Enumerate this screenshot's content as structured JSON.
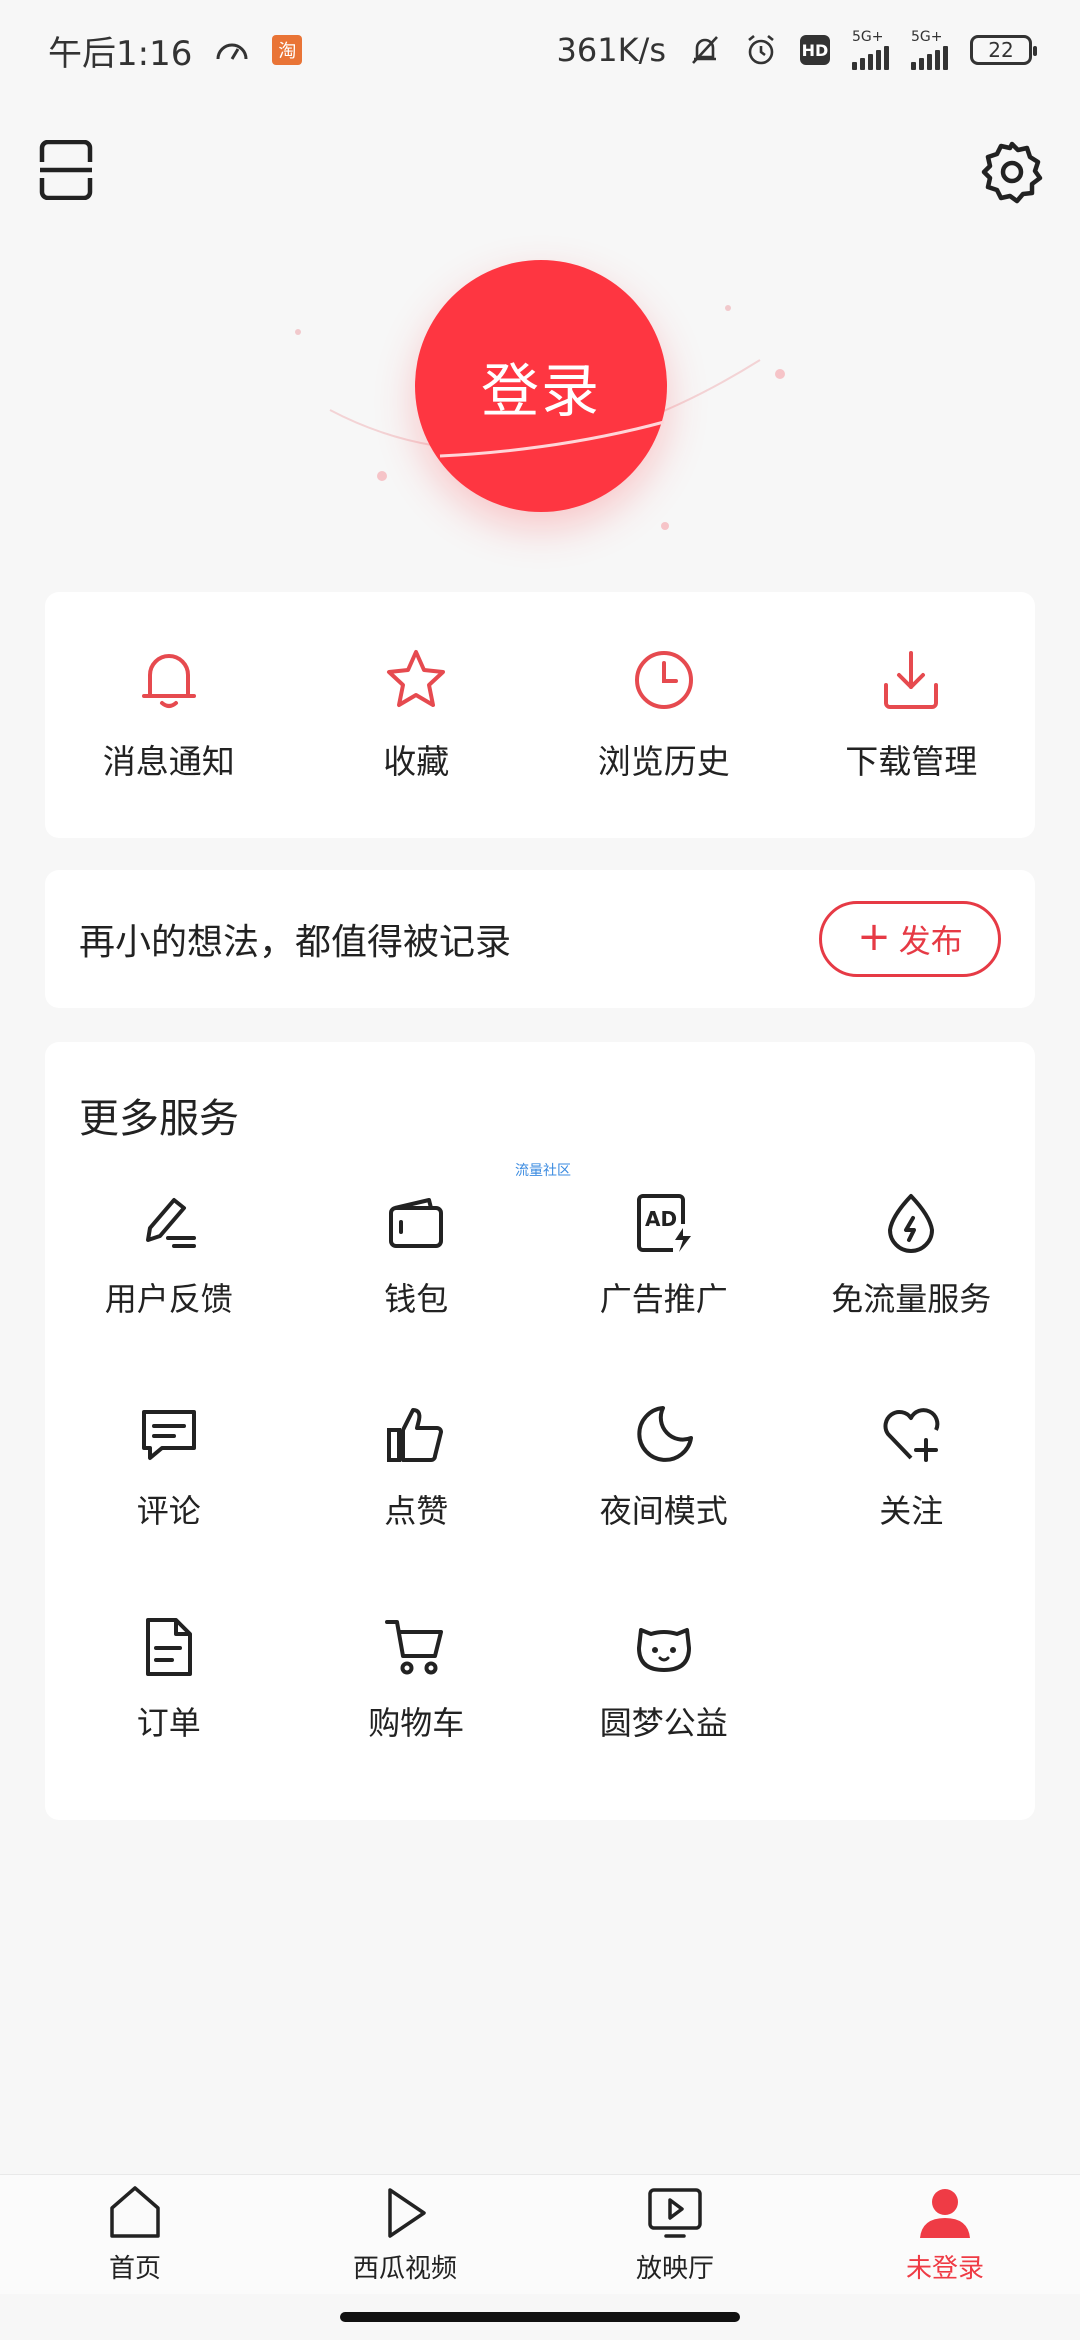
{
  "status_bar": {
    "time": "午后1:16",
    "speed": "361K/s",
    "taobao_badge": "淘",
    "hd": "HD",
    "net1": "5G+",
    "net2": "5G+",
    "battery": "22"
  },
  "login": {
    "label": "登录"
  },
  "quick": [
    {
      "label": "消息通知",
      "icon": "bell-icon"
    },
    {
      "label": "收藏",
      "icon": "star-icon"
    },
    {
      "label": "浏览历史",
      "icon": "clock-icon"
    },
    {
      "label": "下载管理",
      "icon": "download-icon"
    }
  ],
  "post": {
    "text": "再小的想法，都值得被记录",
    "button": "发布",
    "plus": "+"
  },
  "more": {
    "title": "更多服务",
    "watermark": "流量社区",
    "items": [
      {
        "label": "用户反馈",
        "icon": "pencil-icon"
      },
      {
        "label": "钱包",
        "icon": "wallet-icon"
      },
      {
        "label": "广告推广",
        "icon": "ad-icon"
      },
      {
        "label": "免流量服务",
        "icon": "drop-icon"
      },
      {
        "label": "评论",
        "icon": "comment-icon"
      },
      {
        "label": "点赞",
        "icon": "thumb-up-icon"
      },
      {
        "label": "夜间模式",
        "icon": "moon-icon"
      },
      {
        "label": "关注",
        "icon": "heart-plus-icon"
      },
      {
        "label": "订单",
        "icon": "document-icon"
      },
      {
        "label": "购物车",
        "icon": "cart-icon"
      },
      {
        "label": "圆梦公益",
        "icon": "cat-face-icon"
      }
    ]
  },
  "nav": [
    {
      "label": "首页",
      "icon": "home-icon"
    },
    {
      "label": "西瓜视频",
      "icon": "play-icon"
    },
    {
      "label": "放映厅",
      "icon": "tv-play-icon"
    },
    {
      "label": "未登录",
      "icon": "user-icon"
    }
  ],
  "colors": {
    "accent": "#fe3641",
    "icon_red": "#e64a4f",
    "text": "#222222"
  }
}
